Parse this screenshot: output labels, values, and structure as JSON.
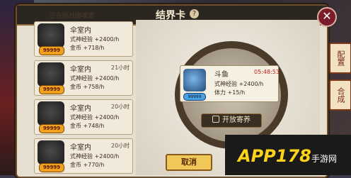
{
  "header": {
    "title": "结界卡",
    "help": "?",
    "close": "✕"
  },
  "notice": "正在挑战御魂寄",
  "cards": [
    {
      "name": "伞室内",
      "time": "",
      "badge": "99999",
      "line1": "式神经验 +2400/h",
      "line2": "金币 +718/h"
    },
    {
      "name": "伞室内",
      "time": "21小时",
      "badge": "99999",
      "line1": "式神经验 +2400/h",
      "line2": "金币 +758/h"
    },
    {
      "name": "伞室内",
      "time": "20小时",
      "badge": "99999",
      "line1": "式神经验 +2400/h",
      "line2": "金币 +748/h"
    },
    {
      "name": "伞室内",
      "time": "20小时",
      "badge": "99999",
      "line1": "式神经验 +2400/h",
      "line2": "金币 +770/h"
    }
  ],
  "selected": {
    "name": "斗鱼",
    "timer": "05:48:53",
    "badge": "99999",
    "line1": "式神经验 +2400/h",
    "line2": "体力 +15/h"
  },
  "open_button": "开放寄养",
  "cancel_button": "取消",
  "side_buttons": {
    "config": "配置",
    "combine": "合成"
  },
  "watermark": {
    "main": "APP178",
    "sub": "手游网"
  }
}
